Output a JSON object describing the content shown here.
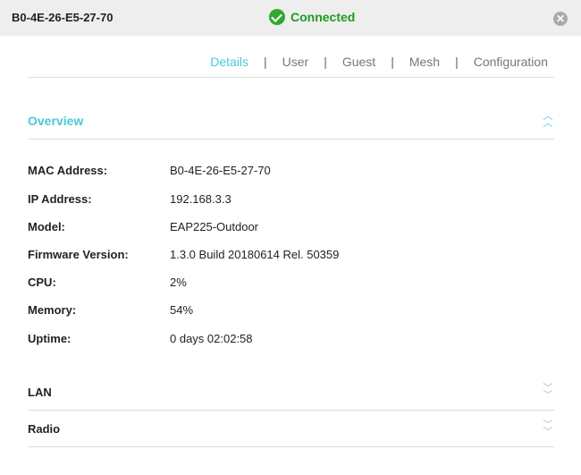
{
  "header": {
    "device_mac": "B0-4E-26-E5-27-70",
    "status": "Connected",
    "close_icon": "close-icon"
  },
  "tabs": [
    {
      "label": "Details",
      "active": true
    },
    {
      "label": "User"
    },
    {
      "label": "Guest"
    },
    {
      "label": "Mesh"
    },
    {
      "label": "Configuration"
    }
  ],
  "tab_separator": "|",
  "overview": {
    "title": "Overview",
    "rows": [
      {
        "label": "MAC Address:",
        "value": "B0-4E-26-E5-27-70"
      },
      {
        "label": "IP Address:",
        "value": "192.168.3.3"
      },
      {
        "label": "Model:",
        "value": "EAP225-Outdoor"
      },
      {
        "label": "Firmware Version:",
        "value": "1.3.0 Build 20180614 Rel. 50359"
      },
      {
        "label": "CPU:",
        "value": "2%"
      },
      {
        "label": "Memory:",
        "value": "54%"
      },
      {
        "label": "Uptime:",
        "value": "0 days 02:02:58"
      }
    ]
  },
  "sections": [
    {
      "title": "LAN"
    },
    {
      "title": "Radio"
    }
  ],
  "colors": {
    "accent": "#4bc8d8",
    "connected": "#1f9a1f"
  }
}
